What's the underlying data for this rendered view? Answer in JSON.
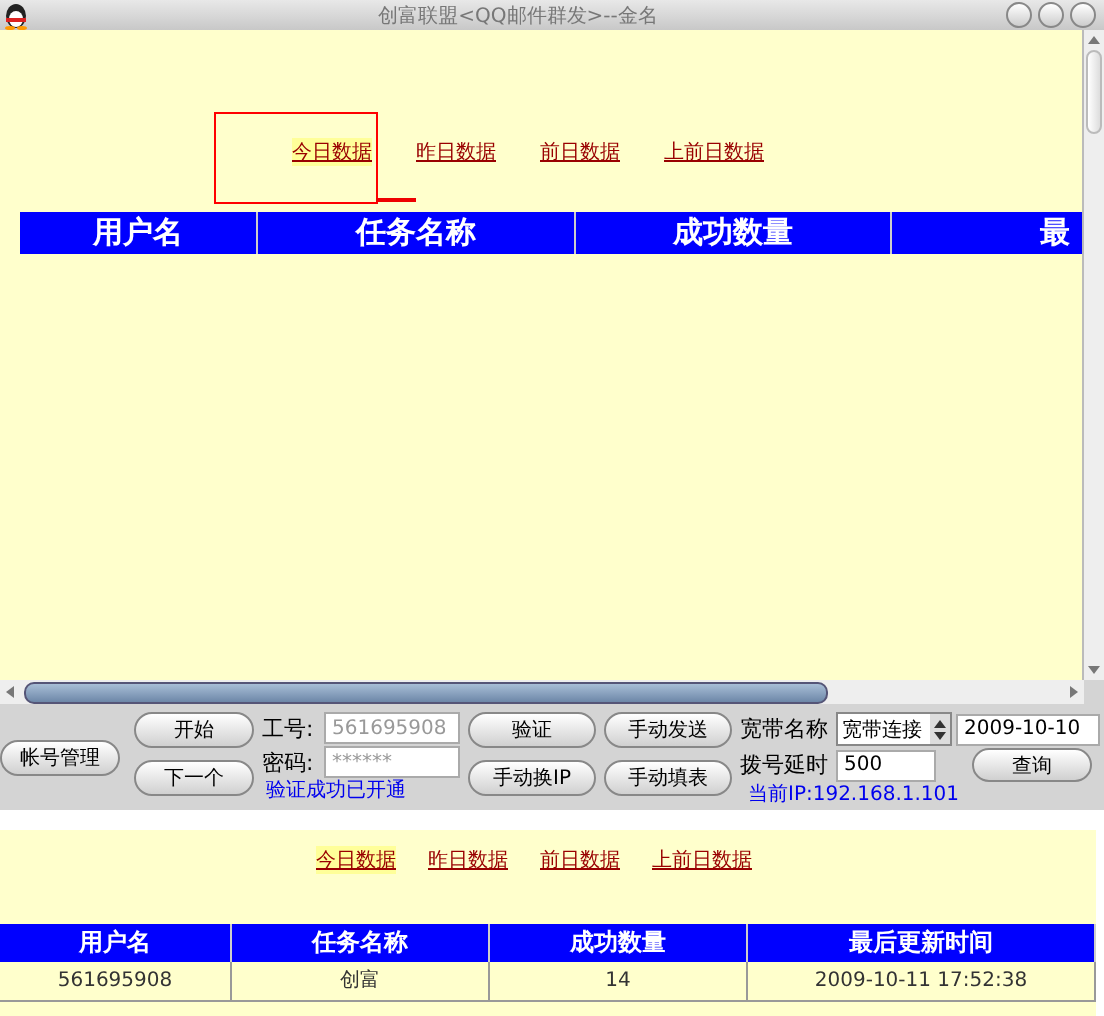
{
  "window": {
    "title": "创富联盟<QQ邮件群发>--金名"
  },
  "top_view": {
    "links": [
      {
        "label": "今日数据",
        "selected": true
      },
      {
        "label": "昨日数据",
        "selected": false
      },
      {
        "label": "前日数据",
        "selected": false
      },
      {
        "label": "上前日数据",
        "selected": false
      }
    ],
    "table": {
      "columns": [
        "用户名",
        "任务名称",
        "成功数量",
        "最"
      ]
    }
  },
  "controls": {
    "account_button": "帐号管理",
    "start_button": "开始",
    "next_button": "下一个",
    "id_field": {
      "label": "工号:",
      "value": "561695908"
    },
    "password_field": {
      "label": "密码:",
      "value": "******"
    },
    "verify_status": "验证成功已开通",
    "verify_button": "验证",
    "change_ip_button": "手动换IP",
    "manual_send_button": "手动发送",
    "manual_fill_button": "手动填表",
    "broadband_label": "宽带名称",
    "broadband_select": "宽带连接",
    "date_field": "2009-10-10",
    "dial_delay_label": "拨号延时",
    "dial_delay_field": "500",
    "query_button": "查询",
    "ip_status": "当前IP:192.168.1.101"
  },
  "bottom_view": {
    "links": [
      {
        "label": "今日数据",
        "selected": true
      },
      {
        "label": "昨日数据",
        "selected": false
      },
      {
        "label": "前日数据",
        "selected": false
      },
      {
        "label": "上前日数据",
        "selected": false
      }
    ],
    "table": {
      "columns": [
        "用户名",
        "任务名称",
        "成功数量",
        "最后更新时间"
      ],
      "rows": [
        [
          "561695908",
          "创富",
          "14",
          "2009-10-11 17:52:38"
        ]
      ]
    }
  }
}
